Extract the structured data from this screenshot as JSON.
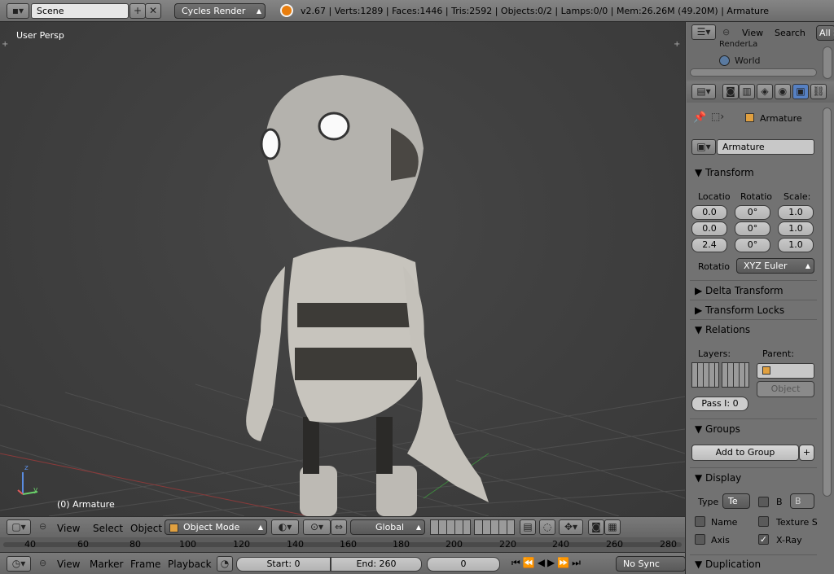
{
  "top": {
    "scene": "Scene",
    "engine": "Cycles Render",
    "info": "v2.67 | Verts:1289 | Faces:1446 | Tris:2592 | Objects:0/2 | Lamps:0/0 | Mem:26.26M (49.20M) | Armature"
  },
  "viewport": {
    "persp": "User Persp",
    "object_label": "(0) Armature",
    "axis_z": "z",
    "axis_y": "y"
  },
  "view_header": {
    "view": "View",
    "select": "Select",
    "object": "Object",
    "mode": "Object Mode",
    "orientation": "Global"
  },
  "timeline": {
    "ticks": [
      "40",
      "60",
      "80",
      "100",
      "120",
      "140",
      "160",
      "180",
      "200",
      "220",
      "240",
      "260",
      "280"
    ]
  },
  "timeline_header": {
    "view": "View",
    "marker": "Marker",
    "frame": "Frame",
    "playback": "Playback",
    "start": "Start: 0",
    "end": "End: 260",
    "current": "0",
    "sync": "No Sync"
  },
  "outliner": {
    "view": "View",
    "search": "Search",
    "all": "All S",
    "item1": "RenderLa",
    "item2": "World"
  },
  "properties": {
    "breadcrumb": "Armature",
    "object_name": "Armature",
    "transform": {
      "title": "Transform",
      "location_label": "Locatio",
      "rotation_label": "Rotatio",
      "scale_label": "Scale:",
      "loc": [
        "0.0",
        "0.0",
        "2.4"
      ],
      "rot": [
        "0°",
        "0°",
        "0°"
      ],
      "scale": [
        "1.0",
        "1.0",
        "1.0"
      ],
      "rot_mode_label": "Rotatio",
      "rot_mode": "XYZ Euler"
    },
    "delta": "Delta Transform",
    "locks": "Transform Locks",
    "relations": {
      "title": "Relations",
      "layers": "Layers:",
      "parent": "Parent:",
      "parent_type": "Object",
      "pass": "Pass I: 0"
    },
    "groups": {
      "title": "Groups",
      "add": "Add to Group"
    },
    "display": {
      "title": "Display",
      "type_label": "Type",
      "type_val": "Te",
      "b_label": "B",
      "b_val": "B",
      "name": "Name",
      "texture": "Texture S",
      "axis": "Axis",
      "xray": "X-Ray"
    },
    "duplication": "Duplication"
  }
}
